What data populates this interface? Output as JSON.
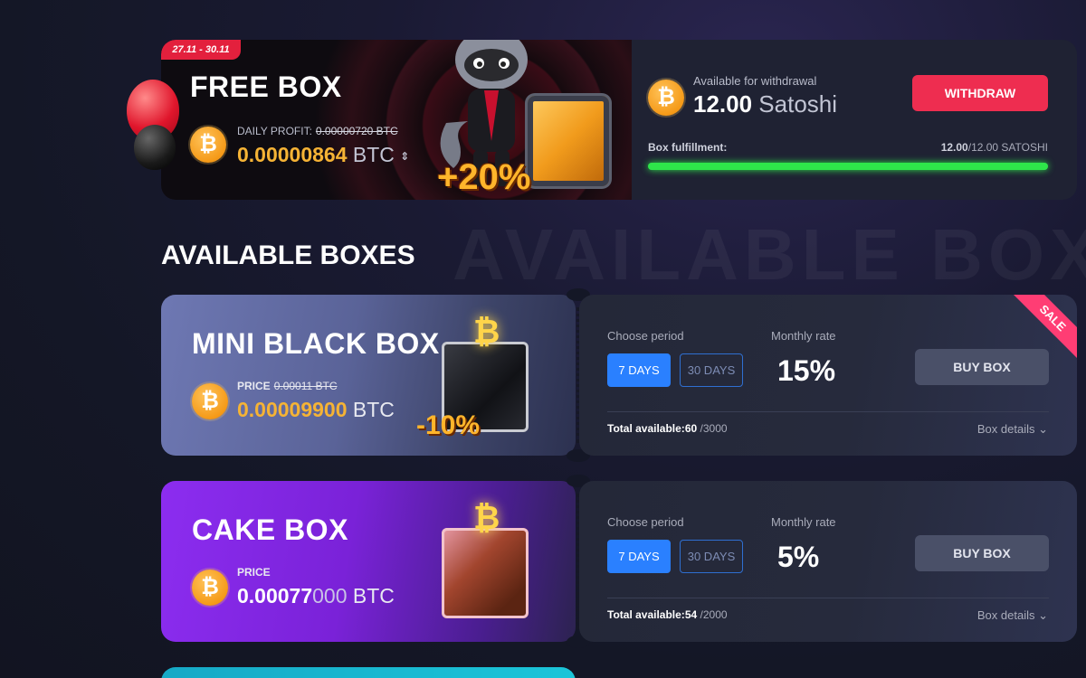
{
  "free_box": {
    "date_range": "27.11 - 30.11",
    "title": "FREE BOX",
    "daily_profit_label": "DAILY PROFIT:",
    "daily_profit_old": "0.00000720 BTC",
    "value_gold": "0.00000864",
    "value_unit": " BTC",
    "bonus_label": "+20%",
    "available_label": "Available for withdrawal",
    "available_amount": "12.00",
    "available_unit": " Satoshi",
    "withdraw_label": "WITHDRAW",
    "fulfillment_label": "Box fulfillment:",
    "fulfillment_current": "12.00",
    "fulfillment_total": "/12.00 SATOSHI",
    "fulfillment_fraction": 1.0
  },
  "section": {
    "title": "AVAILABLE BOXES",
    "watermark": "AVAILABLE BOXES"
  },
  "boxes": [
    {
      "name": "MINI BLACK BOX",
      "price_label": "PRICE",
      "price_old": "0.00011 BTC",
      "price_value": "0.00009900",
      "price_unit": " BTC",
      "discount": "-10%",
      "choose_period_label": "Choose period",
      "period_active": "7 DAYS",
      "period_other": "30 DAYS",
      "monthly_rate_label": "Monthly rate",
      "monthly_rate": "15%",
      "buy_label": "BUY BOX",
      "total_label": "Total available:",
      "total_value": "60",
      "total_max": " /3000",
      "details_label": "Box details",
      "sale_ribbon": "SALE"
    },
    {
      "name": "CAKE BOX",
      "price_label": "PRICE",
      "price_value_main": "0.00077",
      "price_value_tail": "000",
      "price_unit": " BTC",
      "choose_period_label": "Choose period",
      "period_active": "7 DAYS",
      "period_other": "30 DAYS",
      "monthly_rate_label": "Monthly rate",
      "monthly_rate": "5%",
      "buy_label": "BUY BOX",
      "total_label": "Total available:",
      "total_value": "54",
      "total_max": " /2000",
      "details_label": "Box details"
    }
  ],
  "icons": {
    "btc_coin": "bitcoin-icon",
    "sort": "sort-arrows-icon",
    "chevron": "chevron-down-icon"
  },
  "colors": {
    "accent_red": "#ee2d50",
    "accent_blue": "#2a80ff",
    "gold": "#f5b335",
    "progress_green": "#2ee54a",
    "sale_pink": "#ff3d74"
  }
}
